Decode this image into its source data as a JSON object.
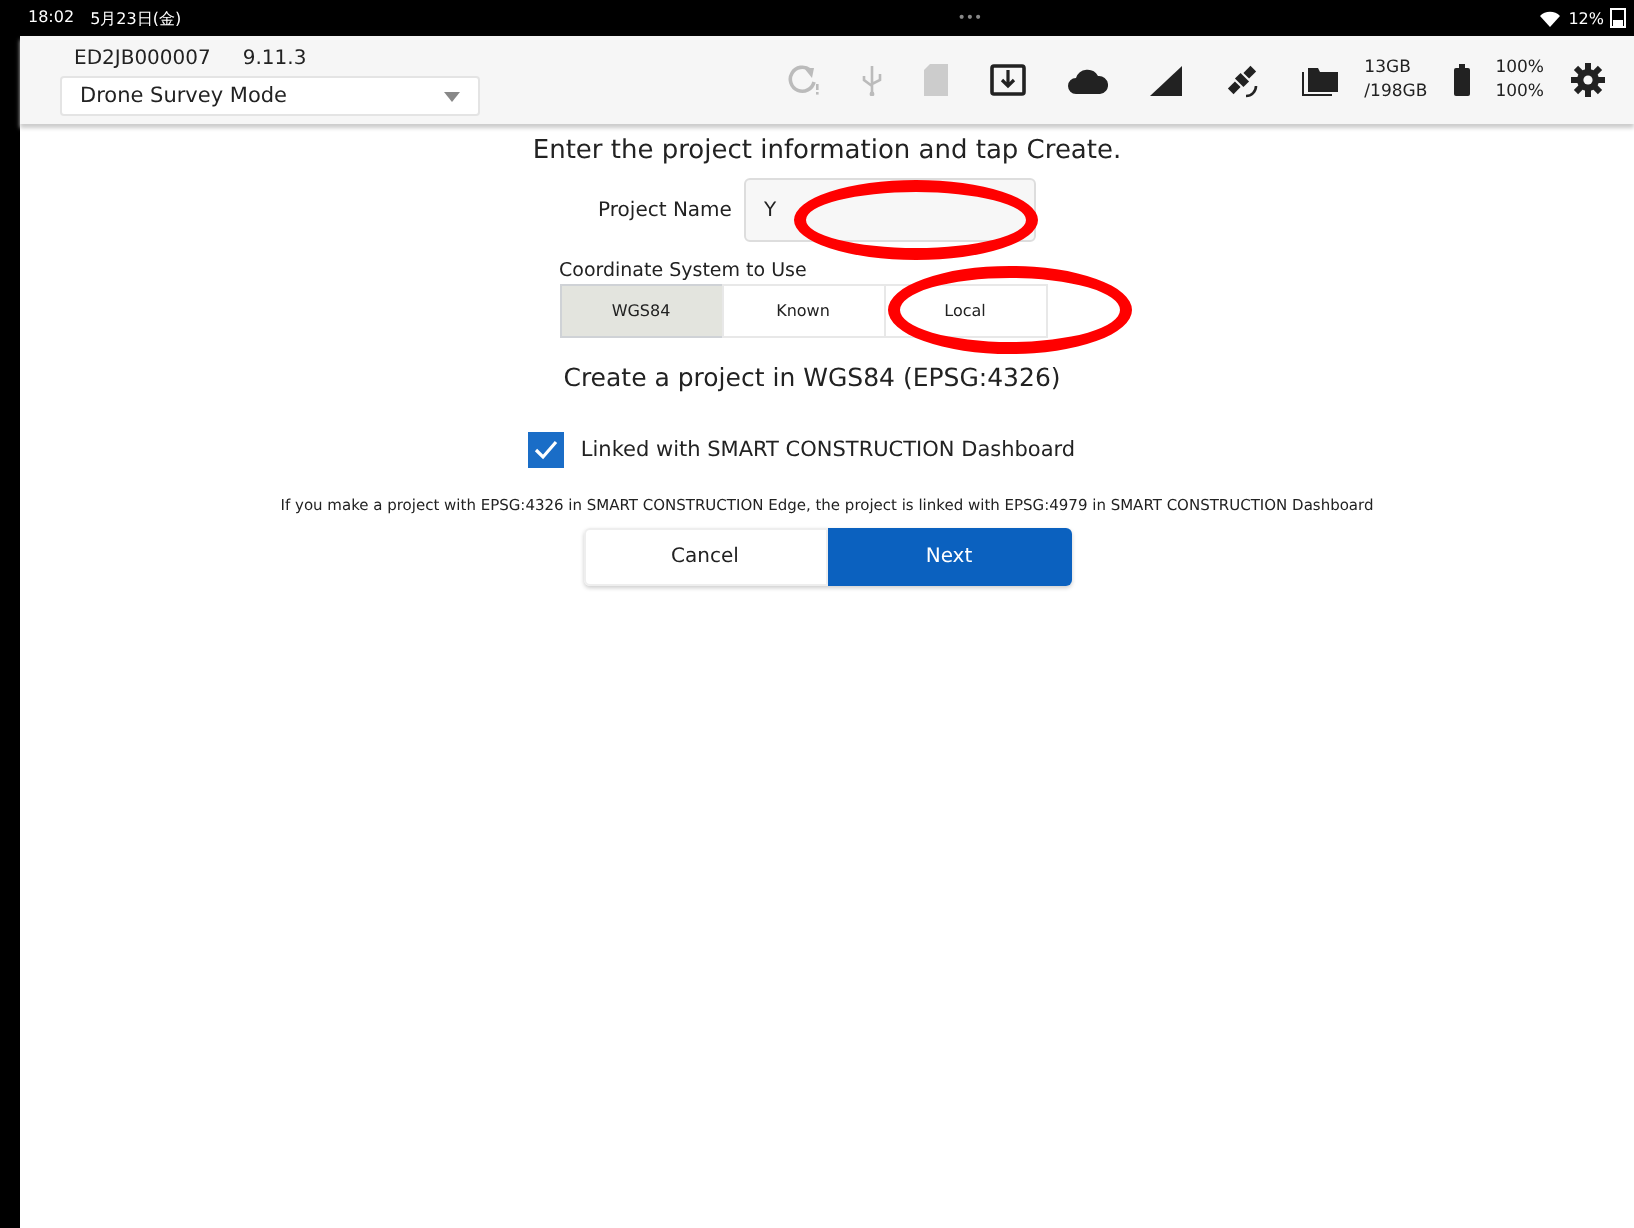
{
  "status_bar": {
    "time": "18:02",
    "date": "5月23日(金)",
    "dots": "•••",
    "battery": "12%"
  },
  "header": {
    "device_id": "ED2JB000007",
    "version": "9.11.3",
    "mode": "Drone Survey Mode",
    "storage_free": "13GB",
    "storage_total": "/198GB",
    "battery_1": "100%",
    "battery_2": "100%"
  },
  "instruction": "Enter the project information and tap Create.",
  "project_name": {
    "label": "Project Name",
    "value": "Y"
  },
  "coordinate_system": {
    "label": "Coordinate System to Use",
    "options": [
      {
        "label": "WGS84",
        "selected": true
      },
      {
        "label": "Known",
        "selected": false
      },
      {
        "label": "Local",
        "selected": false
      }
    ]
  },
  "description": "Create a project in WGS84 (EPSG:4326)",
  "link_option": {
    "label": "Linked with SMART CONSTRUCTION Dashboard",
    "checked": true
  },
  "note": "If you make a project with EPSG:4326 in SMART CONSTRUCTION Edge, the project is linked with EPSG:4979 in SMART CONSTRUCTION Dashboard",
  "buttons": [
    {
      "label": "Cancel",
      "kind": "secondary"
    },
    {
      "label": "Next",
      "kind": "primary"
    }
  ],
  "annotations": [
    {
      "kind": "ellipse"
    },
    {
      "kind": "ellipse"
    }
  ]
}
